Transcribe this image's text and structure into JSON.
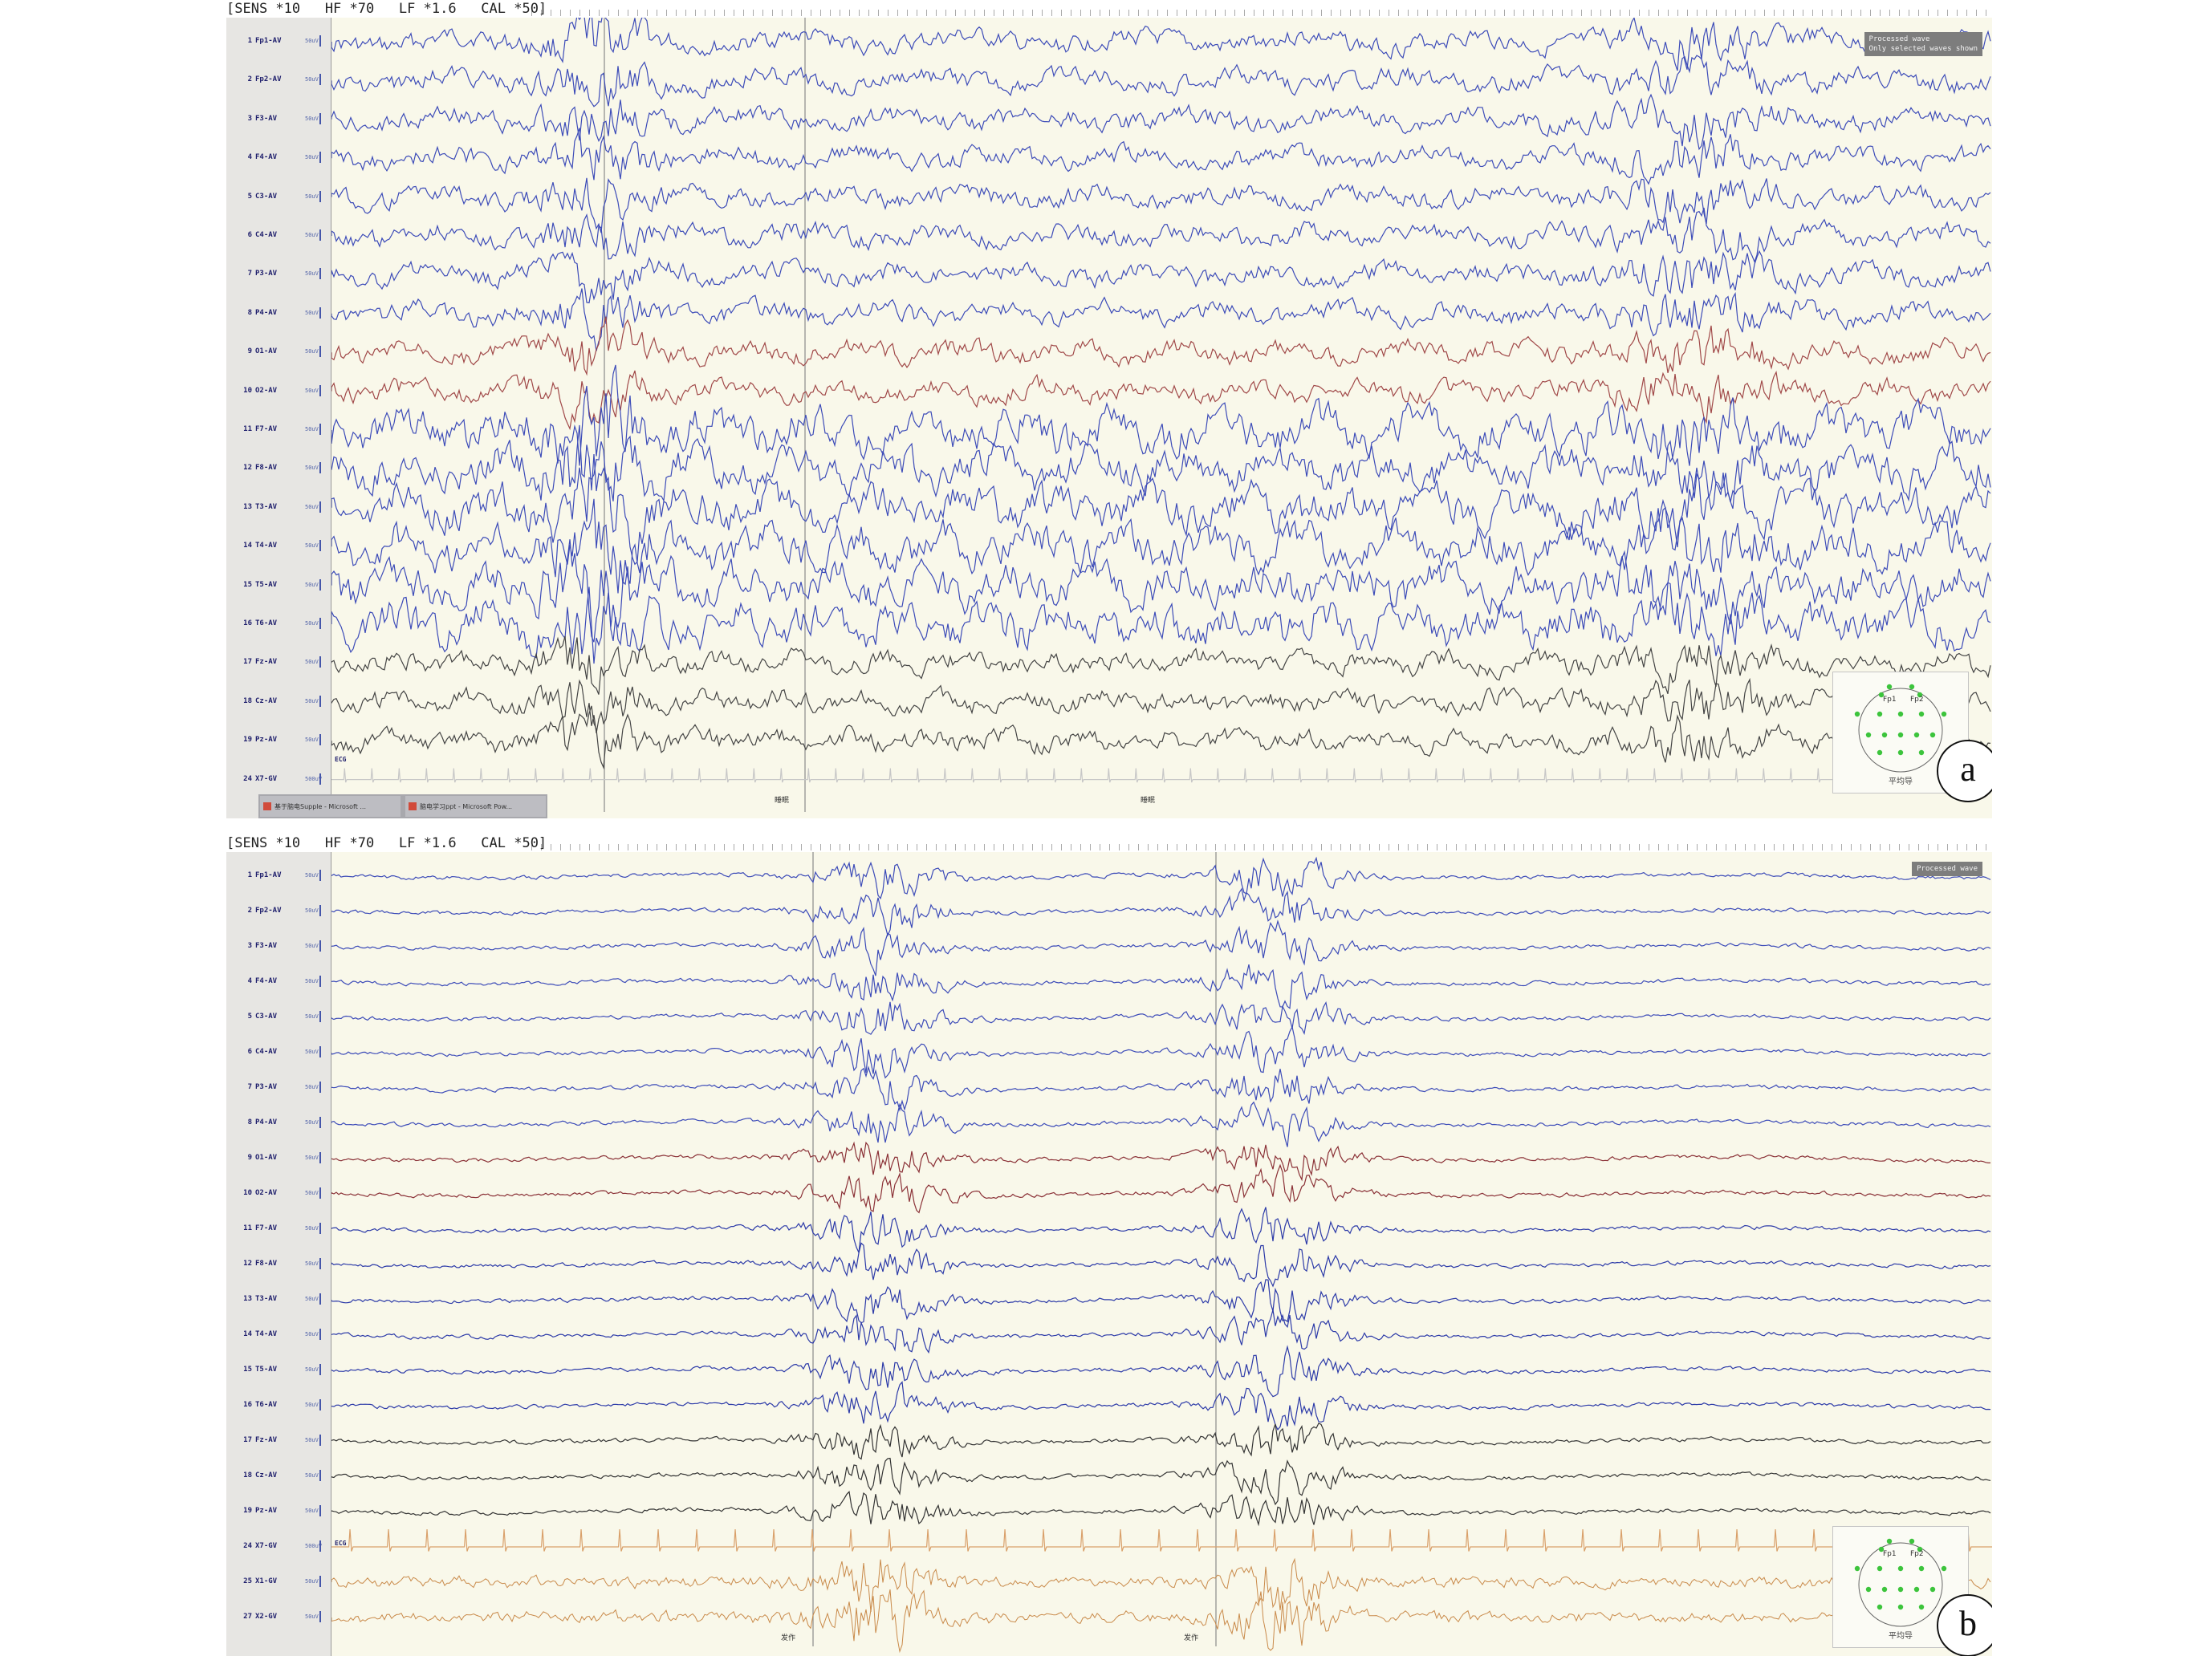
{
  "panels": [
    {
      "id": "a",
      "letter": "a",
      "header": "[SENS *10   HF *70   LF *1.6   CAL *50]",
      "status_lines": [
        "Processed wave",
        "Only selected waves shown"
      ],
      "channels": [
        {
          "num": "1",
          "name": "Fp1-AV",
          "scale": "50uV",
          "color": "#3c4bb8"
        },
        {
          "num": "2",
          "name": "Fp2-AV",
          "scale": "50uV",
          "color": "#3c4bb8"
        },
        {
          "num": "3",
          "name": "F3-AV",
          "scale": "50uV",
          "color": "#3c4bb8"
        },
        {
          "num": "4",
          "name": "F4-AV",
          "scale": "50uV",
          "color": "#3c4bb8"
        },
        {
          "num": "5",
          "name": "C3-AV",
          "scale": "50uV",
          "color": "#3c4bb8"
        },
        {
          "num": "6",
          "name": "C4-AV",
          "scale": "50uV",
          "color": "#3c4bb8"
        },
        {
          "num": "7",
          "name": "P3-AV",
          "scale": "50uV",
          "color": "#3c4bb8"
        },
        {
          "num": "8",
          "name": "P4-AV",
          "scale": "50uV",
          "color": "#3c4bb8"
        },
        {
          "num": "9",
          "name": "O1-AV",
          "scale": "50uV",
          "color": "#a04848"
        },
        {
          "num": "10",
          "name": "O2-AV",
          "scale": "50uV",
          "color": "#a04848"
        },
        {
          "num": "11",
          "name": "F7-AV",
          "scale": "50uV",
          "color": "#3c4bb8"
        },
        {
          "num": "12",
          "name": "F8-AV",
          "scale": "50uV",
          "color": "#3c4bb8"
        },
        {
          "num": "13",
          "name": "T3-AV",
          "scale": "50uV",
          "color": "#3c4bb8"
        },
        {
          "num": "14",
          "name": "T4-AV",
          "scale": "50uV",
          "color": "#3c4bb8"
        },
        {
          "num": "15",
          "name": "T5-AV",
          "scale": "50uV",
          "color": "#3c4bb8"
        },
        {
          "num": "16",
          "name": "T6-AV",
          "scale": "50uV",
          "color": "#3c4bb8"
        },
        {
          "num": "17",
          "name": "Fz-AV",
          "scale": "50uV",
          "color": "#444444"
        },
        {
          "num": "18",
          "name": "Cz-AV",
          "scale": "50uV",
          "color": "#444444"
        },
        {
          "num": "19",
          "name": "Pz-AV",
          "scale": "50uV",
          "color": "#444444"
        },
        {
          "num": "24",
          "name": "X7-GV",
          "scale": "500uV",
          "color": "#c9c9c9"
        }
      ],
      "ecg_label": "ECG",
      "events": [
        "睡眠",
        "睡眠"
      ],
      "head_caption": "平均导",
      "head_labels": [
        "Fp1",
        "Fp2"
      ],
      "taskbar": [
        "基于脑电Supple - Microsoft ...",
        "脑电学习ppt - Microsoft Pow..."
      ]
    },
    {
      "id": "b",
      "letter": "b",
      "header": "[SENS *10   HF *70   LF *1.6   CAL *50]",
      "status_lines": [
        "Processed wave"
      ],
      "channels": [
        {
          "num": "1",
          "name": "Fp1-AV",
          "scale": "50uV",
          "color": "#3c4bb8"
        },
        {
          "num": "2",
          "name": "Fp2-AV",
          "scale": "50uV",
          "color": "#3c4bb8"
        },
        {
          "num": "3",
          "name": "F3-AV",
          "scale": "50uV",
          "color": "#3c4bb8"
        },
        {
          "num": "4",
          "name": "F4-AV",
          "scale": "50uV",
          "color": "#3c4bb8"
        },
        {
          "num": "5",
          "name": "C3-AV",
          "scale": "50uV",
          "color": "#3c4bb8"
        },
        {
          "num": "6",
          "name": "C4-AV",
          "scale": "50uV",
          "color": "#3c4bb8"
        },
        {
          "num": "7",
          "name": "P3-AV",
          "scale": "50uV",
          "color": "#3c4bb8"
        },
        {
          "num": "8",
          "name": "P4-AV",
          "scale": "50uV",
          "color": "#3c4bb8"
        },
        {
          "num": "9",
          "name": "O1-AV",
          "scale": "50uV",
          "color": "#8a3036"
        },
        {
          "num": "10",
          "name": "O2-AV",
          "scale": "50uV",
          "color": "#8a3036"
        },
        {
          "num": "11",
          "name": "F7-AV",
          "scale": "50uV",
          "color": "#2c3aa8"
        },
        {
          "num": "12",
          "name": "F8-AV",
          "scale": "50uV",
          "color": "#2c3aa8"
        },
        {
          "num": "13",
          "name": "T3-AV",
          "scale": "50uV",
          "color": "#2c3aa8"
        },
        {
          "num": "14",
          "name": "T4-AV",
          "scale": "50uV",
          "color": "#2c3aa8"
        },
        {
          "num": "15",
          "name": "T5-AV",
          "scale": "50uV",
          "color": "#2c3aa8"
        },
        {
          "num": "16",
          "name": "T6-AV",
          "scale": "50uV",
          "color": "#2c3aa8"
        },
        {
          "num": "17",
          "name": "Fz-AV",
          "scale": "50uV",
          "color": "#333333"
        },
        {
          "num": "18",
          "name": "Cz-AV",
          "scale": "50uV",
          "color": "#333333"
        },
        {
          "num": "19",
          "name": "Pz-AV",
          "scale": "50uV",
          "color": "#333333"
        },
        {
          "num": "24",
          "name": "X7-GV",
          "scale": "500uV",
          "color": "#d9a06a"
        },
        {
          "num": "25",
          "name": "X1-GV",
          "scale": "50uV",
          "color": "#c98a4a"
        },
        {
          "num": "27",
          "name": "X2-GV",
          "scale": "50uV",
          "color": "#c98a4a"
        }
      ],
      "ecg_label": "ECG",
      "events": [
        "发作",
        "发作"
      ],
      "head_caption": "平均导",
      "head_labels": [
        "Fp1",
        "Fp2"
      ]
    }
  ],
  "colors": {
    "plot_background": "#f9f8ea",
    "label_background": "#e7e6e3",
    "eeg_blue": "#3c4bb8",
    "eeg_red": "#a04848",
    "eeg_dark": "#444444",
    "emg_orange": "#c98a4a",
    "electrode_green": "#3cc43c"
  },
  "icons": [
    "head-map-icon",
    "taskbar-app-icon"
  ]
}
